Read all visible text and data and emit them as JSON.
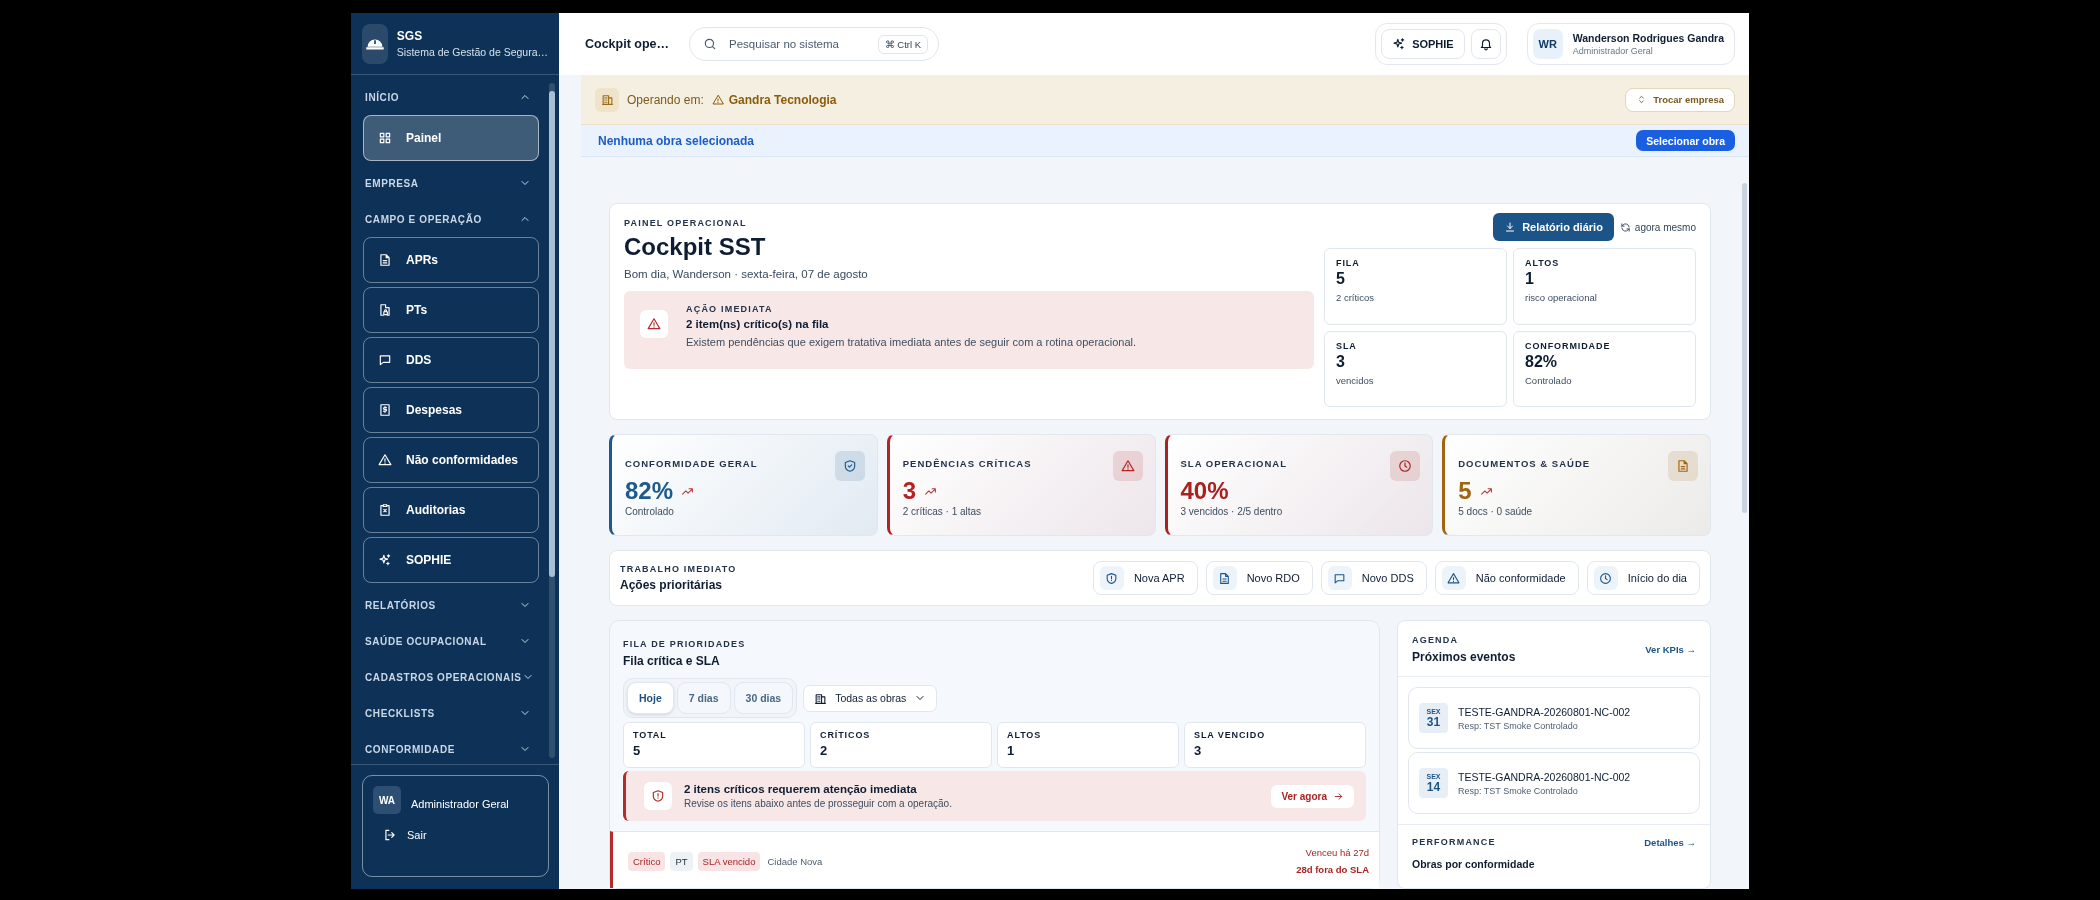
{
  "sidebar": {
    "logo_title": "SGS",
    "logo_subtitle": "Sistema de Gestão de Segura…",
    "sections": [
      {
        "label": "INÍCIO",
        "expanded": true,
        "items": [
          {
            "label": "Painel",
            "selected": true
          }
        ]
      },
      {
        "label": "EMPRESA",
        "expanded": false
      },
      {
        "label": "CAMPO E OPERAÇÃO",
        "expanded": true,
        "items": [
          {
            "label": "APRs",
            "selected": false
          },
          {
            "label": "PTs",
            "selected": false
          },
          {
            "label": "DDS",
            "selected": false
          },
          {
            "label": "Despesas",
            "selected": false
          },
          {
            "label": "Não conformidades",
            "selected": false
          },
          {
            "label": "Auditorias",
            "selected": false
          },
          {
            "label": "SOPHIE",
            "selected": false
          }
        ]
      },
      {
        "label": "RELATÓRIOS",
        "expanded": false
      },
      {
        "label": "SAÚDE OCUPACIONAL",
        "expanded": false
      },
      {
        "label": "CADASTROS OPERACIONAIS",
        "expanded": false
      },
      {
        "label": "CHECKLISTS",
        "expanded": false
      },
      {
        "label": "CONFORMIDADE",
        "expanded": false
      }
    ],
    "user": {
      "initials": "WA",
      "role": "Administrador Geral",
      "logout": "Sair"
    }
  },
  "topbar": {
    "page_title": "Cockpit ope…",
    "search": {
      "placeholder": "Pesquisar no sistema",
      "shortcut_symbol": "⌘",
      "shortcut": "Ctrl K"
    },
    "assistant_button": "SOPHIE",
    "user": {
      "initials": "WR",
      "name": "Wanderson Rodrigues Gandra",
      "role": "Administrador Geral"
    }
  },
  "company_banner": {
    "prefix": "Operando em:",
    "company": "Gandra Tecnologia",
    "button": "Trocar empresa"
  },
  "site_bar": {
    "message": "Nenhuma obra selecionada",
    "button": "Selecionar obra"
  },
  "hero": {
    "eyebrow": "PAINEL OPERACIONAL",
    "title": "Cockpit SST",
    "greeting": "Bom dia, Wanderson · sexta-feira, 07 de agosto",
    "alert": {
      "eyebrow": "AÇÃO IMEDIATA",
      "title": "2 item(ns) crítico(s) na fila",
      "text": "Existem pendências que exigem tratativa imediata antes de seguir com a rotina operacional."
    },
    "report_button": "Relatório diário",
    "refresh": "agora mesmo",
    "stats": [
      {
        "label": "FILA",
        "value": "5",
        "note": "2 críticos"
      },
      {
        "label": "ALTOS",
        "value": "1",
        "note": "risco operacional"
      },
      {
        "label": "SLA",
        "value": "3",
        "note": "vencidos"
      },
      {
        "label": "CONFORMIDADE",
        "value": "82%",
        "note": "Controlado"
      }
    ]
  },
  "kpis": [
    {
      "label": "CONFORMIDADE GERAL",
      "value": "82%",
      "trend": true,
      "note": "Controlado",
      "color": "#1d5a8e"
    },
    {
      "label": "PENDÊNCIAS CRÍTICAS",
      "value": "3",
      "trend": true,
      "note": "2 críticas · 1 altas",
      "color": "#b42323"
    },
    {
      "label": "SLA OPERACIONAL",
      "value": "40%",
      "trend": false,
      "note": "3 vencidos · 2/5 dentro",
      "color": "#a8221f"
    },
    {
      "label": "DOCUMENTOS & SAÚDE",
      "value": "5",
      "trend": true,
      "note": "5 docs · 0 saúde",
      "color": "#a0650e"
    }
  ],
  "quick_actions": {
    "eyebrow": "TRABALHO IMEDIATO",
    "title": "Ações prioritárias",
    "actions": [
      "Nova APR",
      "Novo RDO",
      "Novo DDS",
      "Não conformidade",
      "Início do dia"
    ]
  },
  "queue": {
    "eyebrow": "FILA DE PRIORIDADES",
    "title": "Fila crítica e SLA",
    "periods": [
      {
        "label": "Hoje",
        "selected": true
      },
      {
        "label": "7 dias",
        "selected": false
      },
      {
        "label": "30 dias",
        "selected": false
      }
    ],
    "site_filter": "Todas as obras",
    "counts": [
      {
        "label": "TOTAL",
        "value": "5"
      },
      {
        "label": "CRÍTICOS",
        "value": "2"
      },
      {
        "label": "ALTOS",
        "value": "1"
      },
      {
        "label": "SLA VENCIDO",
        "value": "3"
      }
    ],
    "alert": {
      "title": "2 itens críticos requerem atenção imediata",
      "text": "Revise os itens abaixo antes de prosseguir com a operação.",
      "button": "Ver agora"
    },
    "items": [
      {
        "tags": [
          {
            "label": "Crítico",
            "kind": "danger"
          },
          {
            "label": "PT",
            "kind": "neutral"
          },
          {
            "label": "SLA vencido",
            "kind": "danger"
          }
        ],
        "location": "Cidade Nova",
        "due": "Venceu há 27d",
        "overdue": "28d fora do SLA"
      }
    ]
  },
  "agenda": {
    "eyebrow": "AGENDA",
    "title": "Próximos eventos",
    "link": "Ver KPIs →",
    "events": [
      {
        "weekday": "SEX",
        "day": "31",
        "title": "TESTE-GANDRA-20260801-NC-002",
        "owner": "Resp: TST Smoke Controlado"
      },
      {
        "weekday": "SEX",
        "day": "14",
        "title": "TESTE-GANDRA-20260801-NC-002",
        "owner": "Resp: TST Smoke Controlado"
      }
    ],
    "performance": {
      "eyebrow": "PERFORMANCE",
      "link": "Detalhes →",
      "subtitle": "Obras por conformidade"
    }
  }
}
